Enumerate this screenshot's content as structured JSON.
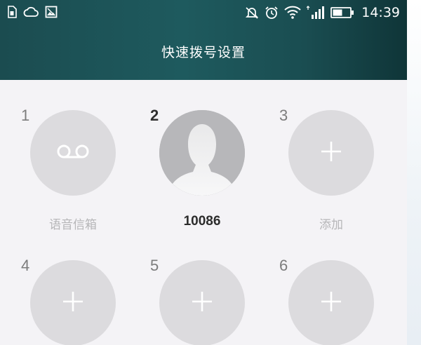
{
  "status_bar": {
    "time": "14:39",
    "left_icons": [
      "sim-card-icon",
      "cloud-icon",
      "image-icon"
    ],
    "right_icons": [
      "mute-icon",
      "alarm-icon",
      "wifi-icon",
      "signal-icon",
      "battery-icon"
    ]
  },
  "header": {
    "title": "快速拨号设置"
  },
  "speed_dial": [
    {
      "number": "1",
      "label": "语音信箱",
      "icon": "voicemail-icon",
      "state": "voicemail"
    },
    {
      "number": "2",
      "label": "10086",
      "icon": "contact-avatar-icon",
      "state": "assigned"
    },
    {
      "number": "3",
      "label": "添加",
      "icon": "plus-icon",
      "state": "empty"
    },
    {
      "number": "4",
      "label": "",
      "icon": "plus-icon",
      "state": "empty"
    },
    {
      "number": "5",
      "label": "",
      "icon": "plus-icon",
      "state": "empty"
    },
    {
      "number": "6",
      "label": "",
      "icon": "plus-icon",
      "state": "empty"
    }
  ],
  "colors": {
    "header": "#1e5a5e",
    "background": "#f4f3f6",
    "slot_empty": "#dcdbde",
    "label_muted": "#b6b6b8"
  }
}
